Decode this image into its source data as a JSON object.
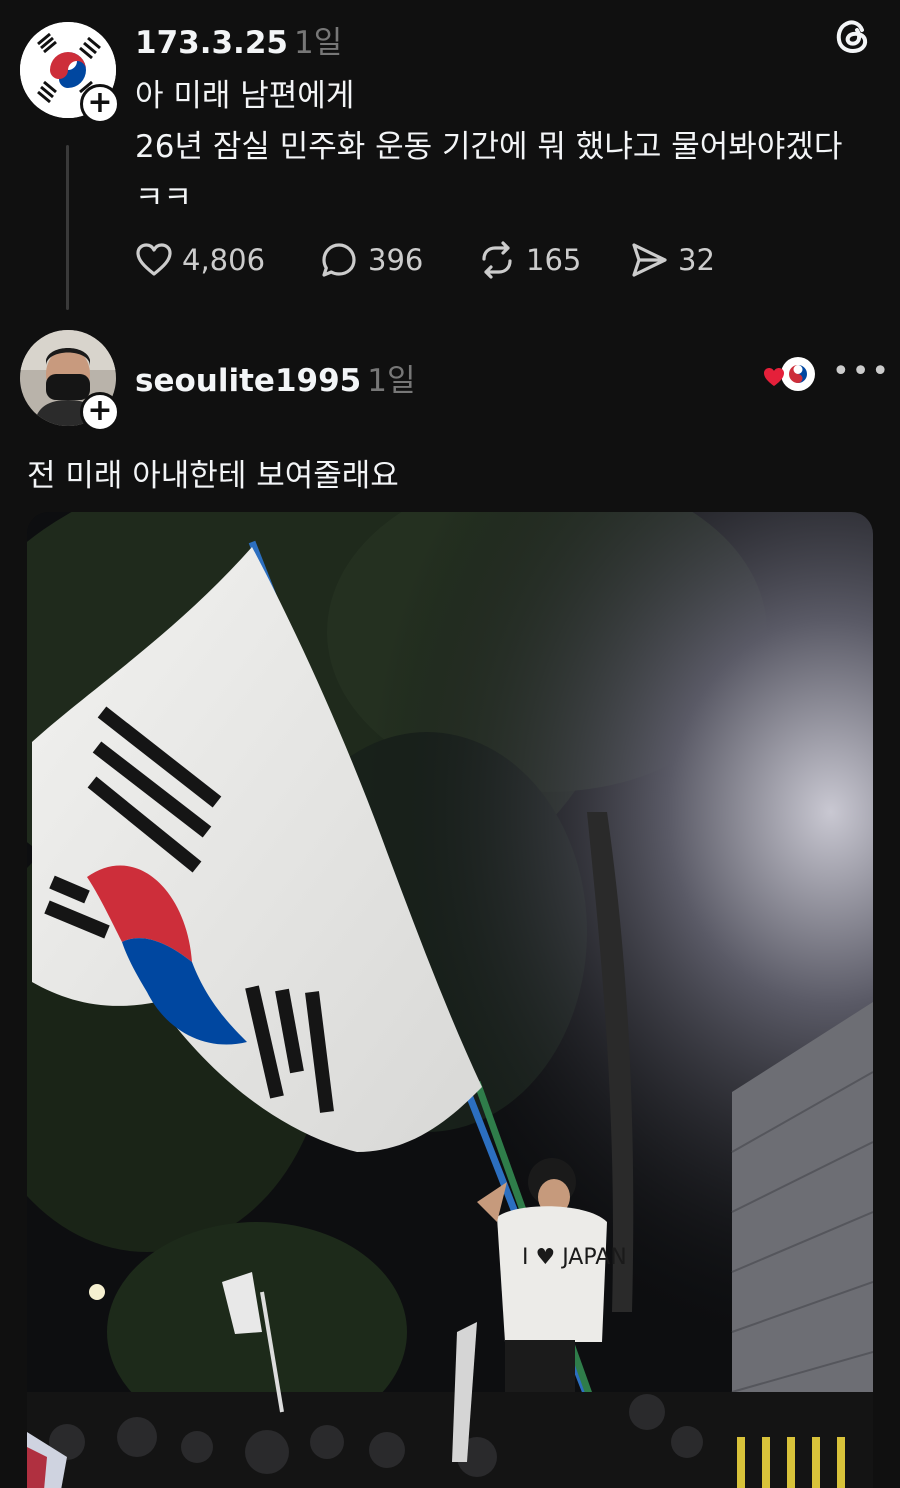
{
  "post1": {
    "username": "173.3.25",
    "time": "1일",
    "lines": [
      "아 미래 남편에게",
      "26년  잠실 민주화 운동 기간에 뭐 했냐고 물어봐야겠다",
      "ㅋㅋ"
    ],
    "actions": {
      "likes": "4,806",
      "comments": "396",
      "reposts": "165",
      "shares": "32"
    }
  },
  "post2": {
    "username": "seoulite1995",
    "time": "1일",
    "text": "전 미래 아내한테 보여줄래요"
  },
  "photo_text": {
    "shirt_text": "I ♥ JAPAN"
  },
  "icons": [
    "threads-logo-icon",
    "heart-icon",
    "comment-icon",
    "repost-icon",
    "share-icon",
    "more-icon",
    "plus-icon"
  ],
  "colors": {
    "background": "#101010",
    "text": "#f3f5f7",
    "muted": "#777777",
    "flag_red": "#cd2e3a",
    "flag_blue": "#0047a0"
  }
}
